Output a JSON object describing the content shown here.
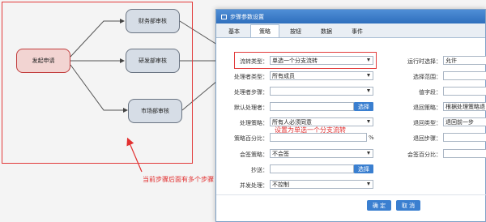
{
  "flow": {
    "nodes": {
      "start": "发起申请",
      "finance": "财务部审核",
      "rnd": "研发部审核",
      "market": "市场部审核"
    },
    "annotation_steps": "当前步骤后面有多个步骤",
    "annotation_single": "设置为单选一个分支流转"
  },
  "dialog": {
    "title": "步骤参数设置",
    "tabs": [
      "基本",
      "策略",
      "按钮",
      "数据",
      "事件"
    ],
    "active_tab": "策略",
    "fields": {
      "flow_type": {
        "label": "流转类型：",
        "value": "单选一个分支流转"
      },
      "handler_type": {
        "label": "处理者类型：",
        "value": "所有成员"
      },
      "handler_step": {
        "label": "处理者步骤：",
        "value": ""
      },
      "default_handler": {
        "label": "默认处理者：",
        "value": "",
        "button": "选择"
      },
      "handle_strategy": {
        "label": "处理策略：",
        "value": "所有人必须同意"
      },
      "strategy_percent": {
        "label": "策略百分比：",
        "value": "",
        "unit": "%"
      },
      "countersign_strategy": {
        "label": "会签策略：",
        "value": "不会签"
      },
      "cc": {
        "label": "抄送：",
        "value": "",
        "button": "选择"
      },
      "concurrent": {
        "label": "并发处理：",
        "value": "不控制"
      },
      "runtime_select": {
        "label": "运行时选择：",
        "value": "允许"
      },
      "select_range": {
        "label": "选择范围：",
        "value": ""
      },
      "value_field": {
        "label": "值字段：",
        "value": ""
      },
      "return_strategy": {
        "label": "退回策略：",
        "value": "根据处理策略退"
      },
      "return_type": {
        "label": "退回类型：",
        "value": "退回前一步"
      },
      "return_step": {
        "label": "退回步骤：",
        "value": ""
      },
      "countersign_percent": {
        "label": "会签百分比：",
        "value": ""
      }
    },
    "ok": "确 定",
    "cancel": "取 消"
  },
  "colors": {
    "accent": "#3a7fd0",
    "annotation": "#e23030",
    "node_fill": "#d6dde6",
    "start_fill": "#f2d4d2"
  }
}
